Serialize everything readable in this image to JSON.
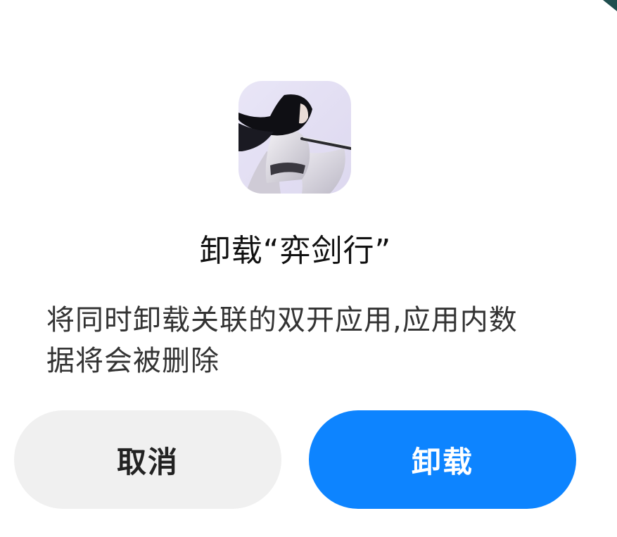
{
  "dialog": {
    "title": "卸载“弈剑行”",
    "message": "将同时卸载关联的双开应用,应用内数据将会被删除",
    "app_icon": "app-icon-swordswoman",
    "buttons": {
      "cancel_label": "取消",
      "uninstall_label": "卸载"
    }
  },
  "colors": {
    "primary": "#0d84ff",
    "secondary_bg": "#f0f0f0",
    "corner_accent": "#1f4e4e"
  }
}
